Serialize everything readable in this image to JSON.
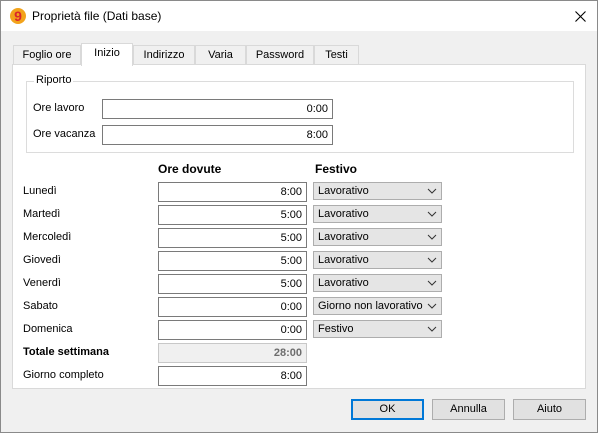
{
  "window": {
    "title": "Proprietà file (Dati base)"
  },
  "tabs": [
    {
      "label": "Foglio ore"
    },
    {
      "label": "Inizio"
    },
    {
      "label": "Indirizzo"
    },
    {
      "label": "Varia"
    },
    {
      "label": "Password"
    },
    {
      "label": "Testi"
    }
  ],
  "active_tab": "Inizio",
  "riporto": {
    "title": "Riporto",
    "ore_lavoro": {
      "label": "Ore lavoro",
      "value": "0:00"
    },
    "ore_vacanza": {
      "label": "Ore vacanza",
      "value": "8:00"
    }
  },
  "headers": {
    "ore_dovute": "Ore dovute",
    "festivo": "Festivo"
  },
  "days": [
    {
      "label": "Lunedì",
      "hours": "8:00",
      "type": "Lavorativo"
    },
    {
      "label": "Martedì",
      "hours": "5:00",
      "type": "Lavorativo"
    },
    {
      "label": "Mercoledì",
      "hours": "5:00",
      "type": "Lavorativo"
    },
    {
      "label": "Giovedì",
      "hours": "5:00",
      "type": "Lavorativo"
    },
    {
      "label": "Venerdì",
      "hours": "5:00",
      "type": "Lavorativo"
    },
    {
      "label": "Sabato",
      "hours": "0:00",
      "type": "Giorno non lavorativo"
    },
    {
      "label": "Domenica",
      "hours": "0:00",
      "type": "Festivo"
    }
  ],
  "totale": {
    "label": "Totale settimana",
    "value": "28:00"
  },
  "giorno_completo": {
    "label": "Giorno completo",
    "value": "8:00"
  },
  "buttons": {
    "ok": "OK",
    "annulla": "Annulla",
    "aiuto": "Aiuto"
  },
  "colors": {
    "accent": "#0078d7",
    "app_icon_red": "#d9262b",
    "app_icon_orange": "#f2a31b"
  },
  "icons": {
    "app": "app-logo-icon",
    "close": "close-icon",
    "dropdown": "chevron-down-icon"
  }
}
